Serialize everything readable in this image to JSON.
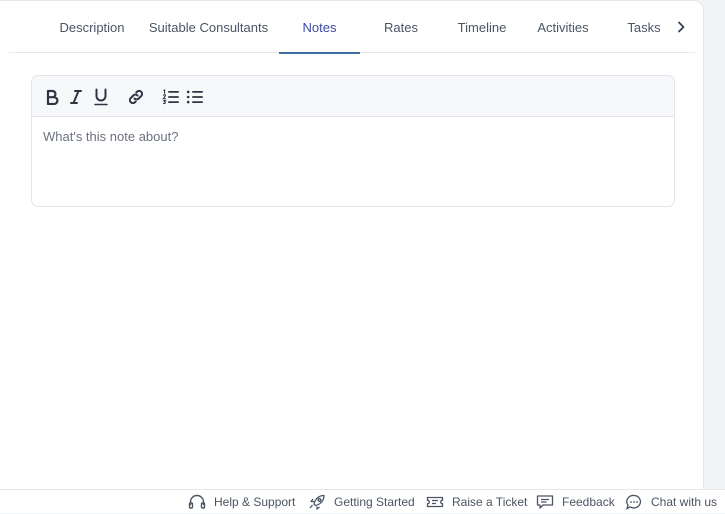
{
  "tabs": [
    {
      "label": "Description",
      "active": false
    },
    {
      "label": "Suitable Consultants",
      "active": false
    },
    {
      "label": "Notes",
      "active": true
    },
    {
      "label": "Rates",
      "active": false
    },
    {
      "label": "Timeline",
      "active": false
    },
    {
      "label": "Activities",
      "active": false
    },
    {
      "label": "Tasks",
      "active": false
    }
  ],
  "tab_scroll_icon": "chevron-right-icon",
  "editor": {
    "toolbar": [
      "bold-icon",
      "italic-icon",
      "underline-icon",
      "link-icon",
      "ordered-list-icon",
      "bullet-list-icon"
    ],
    "value": "",
    "placeholder": "What's this note about?"
  },
  "footer": {
    "items": [
      {
        "label": "Help & Support",
        "icon": "headphones-icon"
      },
      {
        "label": "Getting Started",
        "icon": "rocket-icon"
      },
      {
        "label": "Raise a Ticket",
        "icon": "ticket-icon"
      },
      {
        "label": "Feedback",
        "icon": "feedback-icon"
      },
      {
        "label": "Chat with us",
        "icon": "chat-icon"
      }
    ]
  },
  "colors": {
    "active_tab_text": "#3b4aa6",
    "active_tab_underline": "#3f6f9f",
    "text_muted": "#4b5563"
  }
}
